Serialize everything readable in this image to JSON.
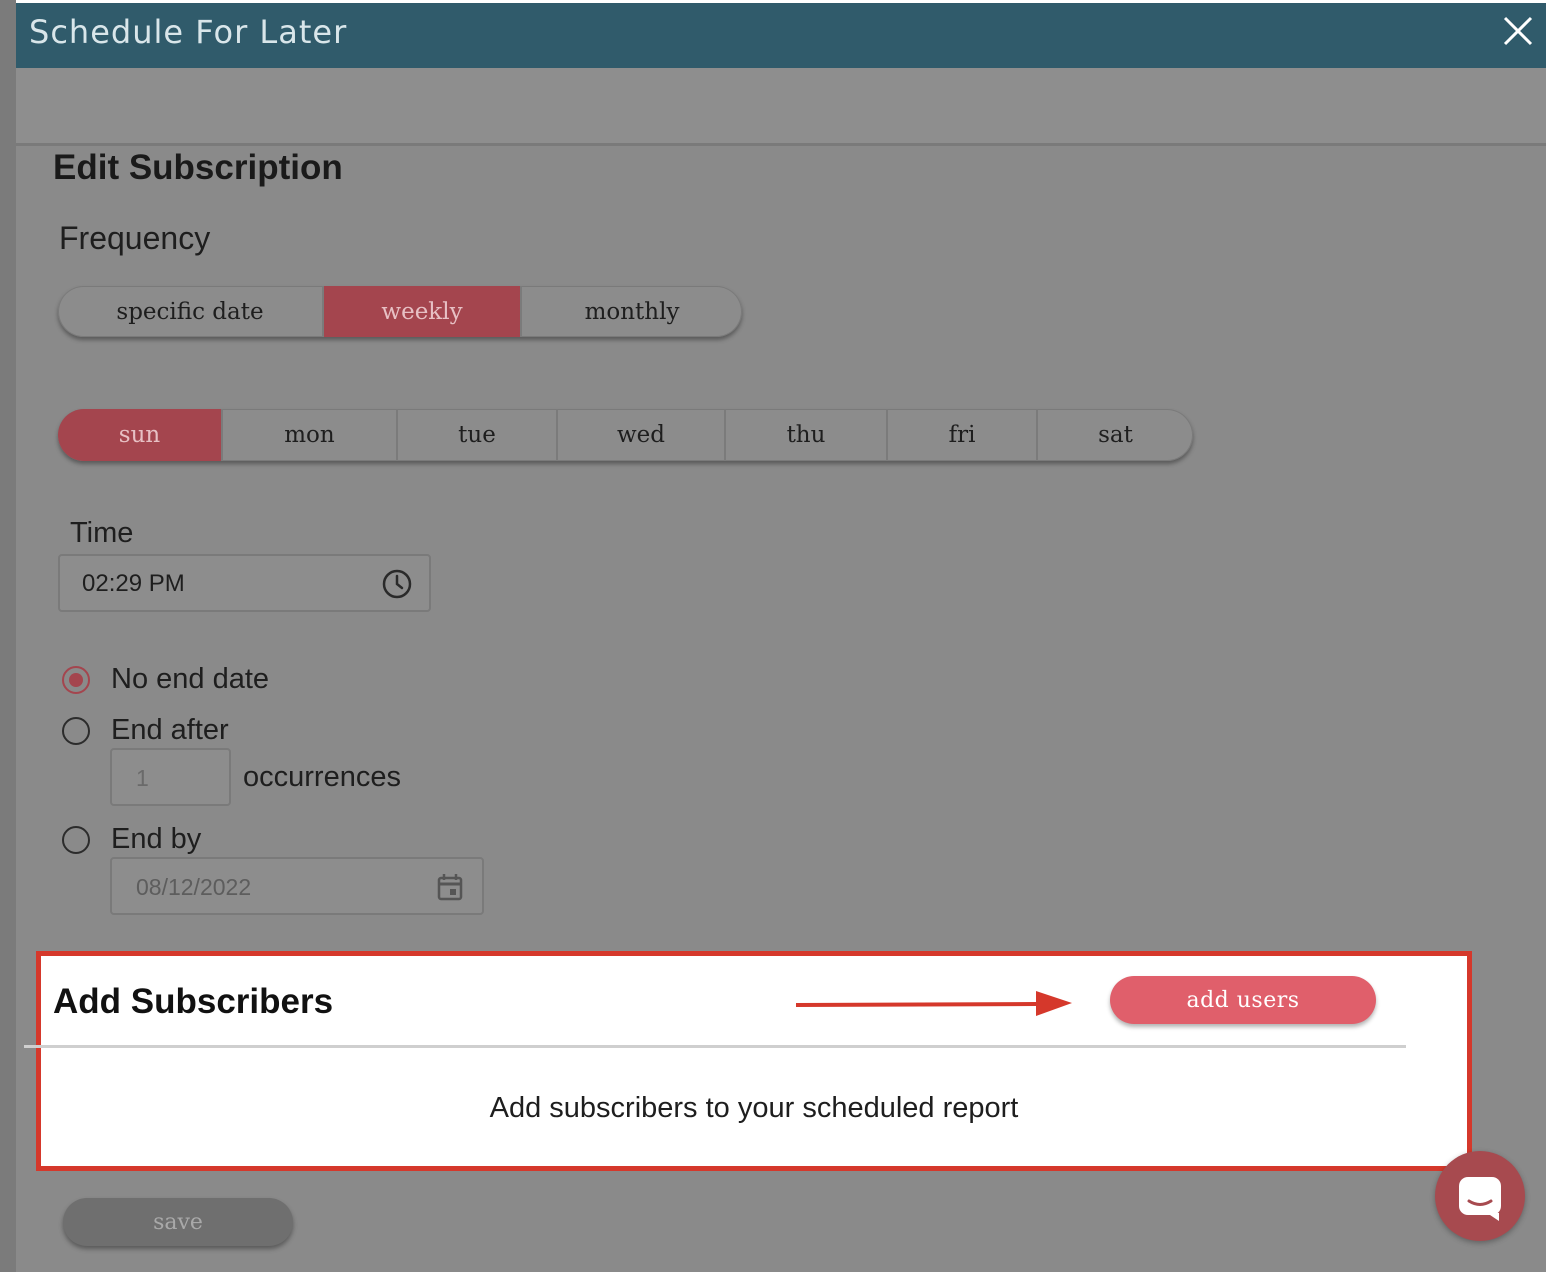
{
  "dialog": {
    "title": "Schedule For Later",
    "heading": "Edit Subscription"
  },
  "frequency": {
    "label": "Frequency",
    "options": [
      "specific date",
      "weekly",
      "monthly"
    ],
    "selected": "weekly"
  },
  "days": {
    "options": [
      "sun",
      "mon",
      "tue",
      "wed",
      "thu",
      "fri",
      "sat"
    ],
    "selected": "sun"
  },
  "time": {
    "label": "Time",
    "value": "02:29 PM"
  },
  "end": {
    "options": {
      "no_end": "No end date",
      "end_after": "End after",
      "end_by": "End by"
    },
    "selected": "No end date",
    "occurrences_value": "1",
    "occurrences_label": "occurrences",
    "end_by_date": "08/12/2022"
  },
  "subscribers": {
    "title": "Add Subscribers",
    "add_button": "add users",
    "empty_message": "Add subscribers to your scheduled report"
  },
  "footer": {
    "save_label": "save"
  },
  "colors": {
    "header": "#305b6b",
    "accent": "#a4454e",
    "add_button": "#e05f6b",
    "highlight_border": "#d5382b"
  },
  "icons": [
    "close-icon",
    "clock-icon",
    "calendar-icon",
    "arrow-right-icon",
    "chat-icon"
  ]
}
